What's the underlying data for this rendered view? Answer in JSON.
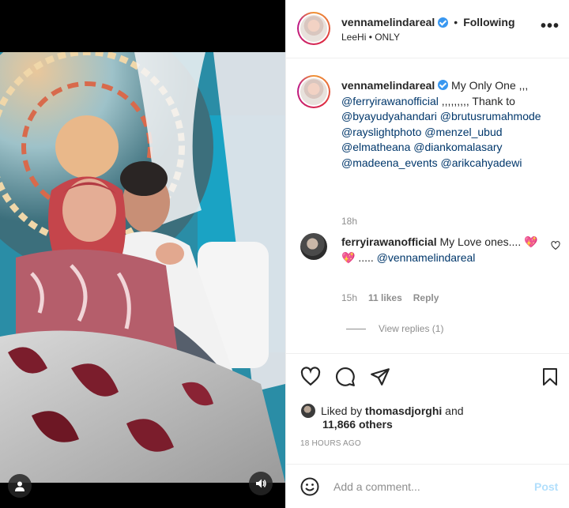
{
  "post": {
    "username": "vennamelindareal",
    "follow_separator": "•",
    "follow_status": "Following",
    "audio": "LeeHi • ONLY",
    "more_label": "•••"
  },
  "caption": {
    "username": "vennamelindareal",
    "text_prefix": " My Only One ,,, ",
    "mention_1": "@ferryirawanofficial",
    "text_mid": " ,,,,,,,,, Thank to ",
    "mentions": "@byayudyahandari @brutusrumahmode @rayslightphoto @menzel_ubud @elmatheana @diankomalasary @madeena_events @arikcahyadewi",
    "time": "18h"
  },
  "comment": {
    "username": "ferryirawanofficial",
    "text": " My Love ones.... 💖💖 ..... ",
    "mention": "@vennamelindareal",
    "time": "15h",
    "likes": "11 likes",
    "reply_label": "Reply",
    "view_replies": "View replies (1)"
  },
  "likes": {
    "prefix": "Liked by ",
    "user": "thomasdjorghi",
    "connector": " and",
    "others": "11,866 others"
  },
  "posted_ago": "18 HOURS AGO",
  "add_comment": {
    "placeholder": "Add a comment...",
    "post_label": "Post"
  },
  "colors": {
    "link": "#00376b",
    "post_disabled": "#b2dffc",
    "verified": "#3897f0",
    "muted": "#8e8e8e"
  },
  "icons": [
    "tag-user-icon",
    "volume-icon",
    "verified-badge-icon",
    "more-options-icon",
    "heart-icon",
    "comment-icon",
    "share-icon",
    "bookmark-icon",
    "emoji-icon"
  ]
}
